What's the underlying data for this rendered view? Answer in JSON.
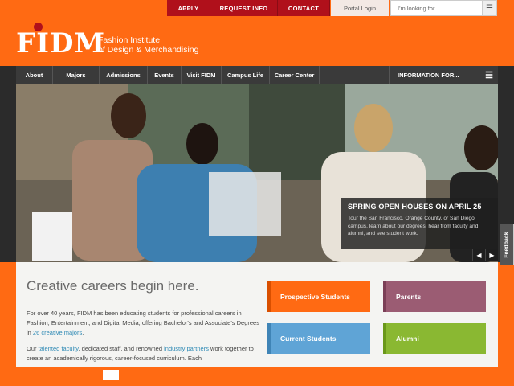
{
  "utility": {
    "apply": "APPLY",
    "request_info": "REQUEST INFO",
    "contact": "CONTACT",
    "portal_login": "Portal Login",
    "search_placeholder": "I'm looking for ..."
  },
  "logo": {
    "mark": "FIDM",
    "line1": "Fashion Institute",
    "line2": "of Design & Merchandising"
  },
  "nav": {
    "items": [
      "About",
      "Majors",
      "Admissions",
      "Events",
      "Visit FIDM",
      "Campus Life",
      "Career Center"
    ],
    "info_for": "INFORMATION FOR..."
  },
  "hero": {
    "caption_title": "SPRING OPEN HOUSES ON APRIL 25",
    "caption_text": "Tour the San Francisco, Orange County, or San Diego campus, learn about our degrees, hear from faculty and alumni, and see student work.",
    "prev": "◀",
    "next": "▶",
    "feedback": "Feedback"
  },
  "content": {
    "heading": "Creative careers begin here.",
    "p1_a": "For over 40 years, FIDM has been educating students for professional careers in Fashion, Entertainment, and Digital Media, offering Bachelor's and Associate's Degrees in ",
    "p1_link": "26 creative majors",
    "p1_b": ".",
    "p2_a": "Our ",
    "p2_link1": "talented faculty",
    "p2_b": ", dedicated staff, and renowned ",
    "p2_link2": "industry partners",
    "p2_c": " work together to create an academically rigorous, career-focused curriculum. Each"
  },
  "cta": {
    "prospective": "Prospective Students",
    "parents": "Parents",
    "current": "Current Students",
    "alumni": "Alumni"
  },
  "colors": {
    "orange": "#ff6a13",
    "red": "#b0101b",
    "nav": "#3a3a3a",
    "prospective": "#ff6a13",
    "parents": "#9b5c73",
    "current": "#5fa4d6",
    "alumni": "#8ab832"
  }
}
